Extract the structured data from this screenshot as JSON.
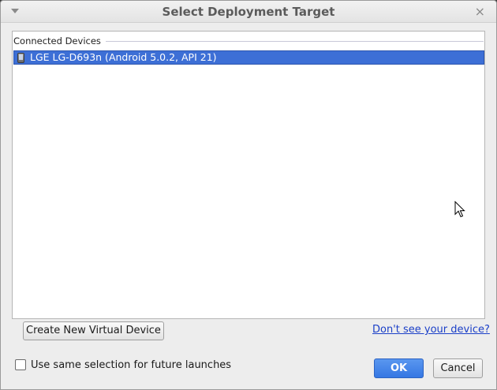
{
  "window": {
    "title": "Select Deployment Target",
    "close_glyph": "×"
  },
  "device_list": {
    "group_label": "Connected Devices",
    "devices": [
      {
        "label": "LGE LG-D693n (Android 5.0.2, API 21)",
        "selected": true,
        "icon": "phone-icon"
      }
    ]
  },
  "footer": {
    "create_button_label": "Create New Virtual Device",
    "help_link_label": "Don't see your device?",
    "reuse_checkbox_label": "Use same selection for future launches",
    "reuse_checked": false,
    "ok_label": "OK",
    "cancel_label": "Cancel"
  },
  "colors": {
    "selection": "#3d6fd6",
    "ok_button": "#3577e3",
    "link": "#1a3fc8"
  }
}
